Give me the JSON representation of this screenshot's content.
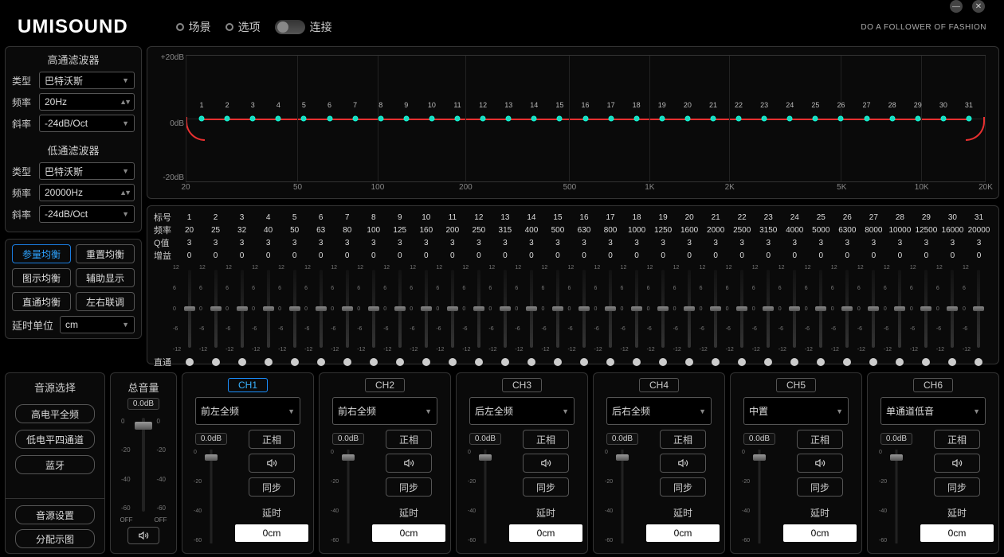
{
  "logo": "UMISOUND",
  "menu": {
    "scene": "场景",
    "options": "选项",
    "connect": "连接"
  },
  "tagline": "DO A FOLLOWER OF FASHION",
  "hpf": {
    "title": "高通滤波器",
    "type_label": "类型",
    "type_value": "巴特沃斯",
    "freq_label": "频率",
    "freq_value": "20Hz",
    "slope_label": "斜率",
    "slope_value": "-24dB/Oct"
  },
  "lpf": {
    "title": "低通滤波器",
    "type_label": "类型",
    "type_value": "巴特沃斯",
    "freq_label": "频率",
    "freq_value": "20000Hz",
    "slope_label": "斜率",
    "slope_value": "-24dB/Oct"
  },
  "eq_buttons": {
    "param_eq": "参量均衡",
    "reset_eq": "重置均衡",
    "graphic_eq": "图示均衡",
    "aux_display": "辅助显示",
    "bypass_eq": "直通均衡",
    "link_lr": "左右联调"
  },
  "delay_unit": {
    "label": "延时单位",
    "value": "cm"
  },
  "graph": {
    "y_top": "+20dB",
    "y_mid": "0dB",
    "y_bot": "-20dB",
    "x": [
      "20",
      "50",
      "100",
      "200",
      "500",
      "1K",
      "2K",
      "5K",
      "10K",
      "20K"
    ]
  },
  "eq_table": {
    "labels": {
      "index": "标号",
      "freq": "频率",
      "q": "Q值",
      "gain": "增益",
      "bypass": "直通"
    },
    "indices": [
      "1",
      "2",
      "3",
      "4",
      "5",
      "6",
      "7",
      "8",
      "9",
      "10",
      "11",
      "12",
      "13",
      "14",
      "15",
      "16",
      "17",
      "18",
      "19",
      "20",
      "21",
      "22",
      "23",
      "24",
      "25",
      "26",
      "27",
      "28",
      "29",
      "30",
      "31"
    ],
    "freqs": [
      "20",
      "25",
      "32",
      "40",
      "50",
      "63",
      "80",
      "100",
      "125",
      "160",
      "200",
      "250",
      "315",
      "400",
      "500",
      "630",
      "800",
      "1000",
      "1250",
      "1600",
      "2000",
      "2500",
      "3150",
      "4000",
      "5000",
      "6300",
      "8000",
      "10000",
      "12500",
      "16000",
      "20000"
    ],
    "qs": [
      "3",
      "3",
      "3",
      "3",
      "3",
      "3",
      "3",
      "3",
      "3",
      "3",
      "3",
      "3",
      "3",
      "3",
      "3",
      "3",
      "3",
      "3",
      "3",
      "3",
      "3",
      "3",
      "3",
      "3",
      "3",
      "3",
      "3",
      "3",
      "3",
      "3",
      "3"
    ],
    "gains": [
      "0",
      "0",
      "0",
      "0",
      "0",
      "0",
      "0",
      "0",
      "0",
      "0",
      "0",
      "0",
      "0",
      "0",
      "0",
      "0",
      "0",
      "0",
      "0",
      "0",
      "0",
      "0",
      "0",
      "0",
      "0",
      "0",
      "0",
      "0",
      "0",
      "0",
      "0"
    ],
    "slider_ticks": [
      "12",
      "6",
      "0",
      "-6",
      "-12"
    ]
  },
  "source": {
    "title": "音源选择",
    "hi_full": "高电平全频",
    "lo_four": "低电平四通道",
    "bt": "蓝牙",
    "settings": "音源设置",
    "assign": "分配示图"
  },
  "master": {
    "title": "总音量",
    "db": "0.0dB",
    "off": "OFF",
    "ticks": [
      "0",
      "-20",
      "-40",
      "-60"
    ]
  },
  "channels": [
    {
      "name": "CH1",
      "type": "前左全频",
      "db": "0.0dB",
      "phase": "正相",
      "sync": "同步",
      "delay_label": "延时",
      "delay": "0cm",
      "active": true
    },
    {
      "name": "CH2",
      "type": "前右全频",
      "db": "0.0dB",
      "phase": "正相",
      "sync": "同步",
      "delay_label": "延时",
      "delay": "0cm",
      "active": false
    },
    {
      "name": "CH3",
      "type": "后左全频",
      "db": "0.0dB",
      "phase": "正相",
      "sync": "同步",
      "delay_label": "延时",
      "delay": "0cm",
      "active": false
    },
    {
      "name": "CH4",
      "type": "后右全频",
      "db": "0.0dB",
      "phase": "正相",
      "sync": "同步",
      "delay_label": "延时",
      "delay": "0cm",
      "active": false
    },
    {
      "name": "CH5",
      "type": "中置",
      "db": "0.0dB",
      "phase": "正相",
      "sync": "同步",
      "delay_label": "延时",
      "delay": "0cm",
      "active": false
    },
    {
      "name": "CH6",
      "type": "单通道低音",
      "db": "0.0dB",
      "phase": "正相",
      "sync": "同步",
      "delay_label": "延时",
      "delay": "0cm",
      "active": false
    }
  ],
  "ch_ticks": [
    "0",
    "-20",
    "-40",
    "-60"
  ]
}
